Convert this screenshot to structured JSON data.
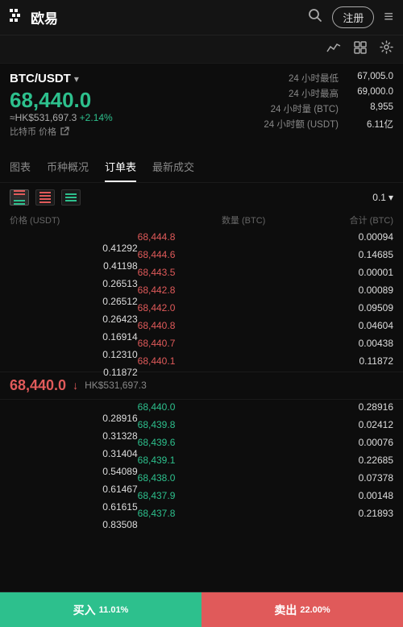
{
  "header": {
    "logo_text": "欧易",
    "register_label": "注册",
    "menu_icon": "≡",
    "search_icon": "🔍"
  },
  "subheader": {
    "chart_icon": "📈",
    "grid_icon": "▦",
    "settings_icon": "⚙"
  },
  "price_info": {
    "pair": "BTC/USDT",
    "main_price": "68,440.0",
    "hk_price": "≈HK$531,697.3",
    "change_pct": "+2.14%",
    "coin_label": "比特币 价格",
    "low_24h_label": "24 小时最低",
    "low_24h_value": "67,005.0",
    "high_24h_label": "24 小时最高",
    "high_24h_value": "69,000.0",
    "vol_btc_label": "24 小时量 (BTC)",
    "vol_btc_value": "8,955",
    "vol_usdt_label": "24 小时额 (USDT)",
    "vol_usdt_value": "6.11亿"
  },
  "tabs": [
    {
      "label": "图表",
      "active": false
    },
    {
      "label": "币种概况",
      "active": false
    },
    {
      "label": "订单表",
      "active": true
    },
    {
      "label": "最新成交",
      "active": false
    }
  ],
  "orderbook": {
    "decimal_selector": "0.1",
    "headers": {
      "price": "价格 (USDT)",
      "qty": "数量 (BTC)",
      "total": "合计 (BTC)"
    },
    "asks": [
      {
        "price": "68,444.8",
        "qty": "0.00094",
        "total": "0.41292",
        "bar_pct": 90
      },
      {
        "price": "68,444.6",
        "qty": "0.14685",
        "total": "0.41198",
        "bar_pct": 80
      },
      {
        "price": "68,443.5",
        "qty": "0.00001",
        "total": "0.26513",
        "bar_pct": 55
      },
      {
        "price": "68,442.8",
        "qty": "0.00089",
        "total": "0.26512",
        "bar_pct": 54
      },
      {
        "price": "68,442.0",
        "qty": "0.09509",
        "total": "0.26423",
        "bar_pct": 52
      },
      {
        "price": "68,440.8",
        "qty": "0.04604",
        "total": "0.16914",
        "bar_pct": 35
      },
      {
        "price": "68,440.7",
        "qty": "0.00438",
        "total": "0.12310",
        "bar_pct": 25
      },
      {
        "price": "68,440.1",
        "qty": "0.11872",
        "total": "0.11872",
        "bar_pct": 20
      }
    ],
    "mid_price": "68,440.0",
    "mid_hk": "HK$531,697.3",
    "bids": [
      {
        "price": "68,440.0",
        "qty": "0.28916",
        "total": "0.28916",
        "bar_pct": 25
      },
      {
        "price": "68,439.8",
        "qty": "0.02412",
        "total": "0.31328",
        "bar_pct": 28
      },
      {
        "price": "68,439.6",
        "qty": "0.00076",
        "total": "0.31404",
        "bar_pct": 28
      },
      {
        "price": "68,439.1",
        "qty": "0.22685",
        "total": "0.54089",
        "bar_pct": 48
      },
      {
        "price": "68,438.0",
        "qty": "0.07378",
        "total": "0.61467",
        "bar_pct": 55
      },
      {
        "price": "68,437.9",
        "qty": "0.00148",
        "total": "0.61615",
        "bar_pct": 56
      },
      {
        "price": "68,437.8",
        "qty": "0.21893",
        "total": "0.83508",
        "bar_pct": 75
      }
    ]
  },
  "bottom": {
    "buy_label": "买入",
    "buy_pct": "11.01%",
    "sell_label": "卖出",
    "sell_pct": "22.00%"
  }
}
